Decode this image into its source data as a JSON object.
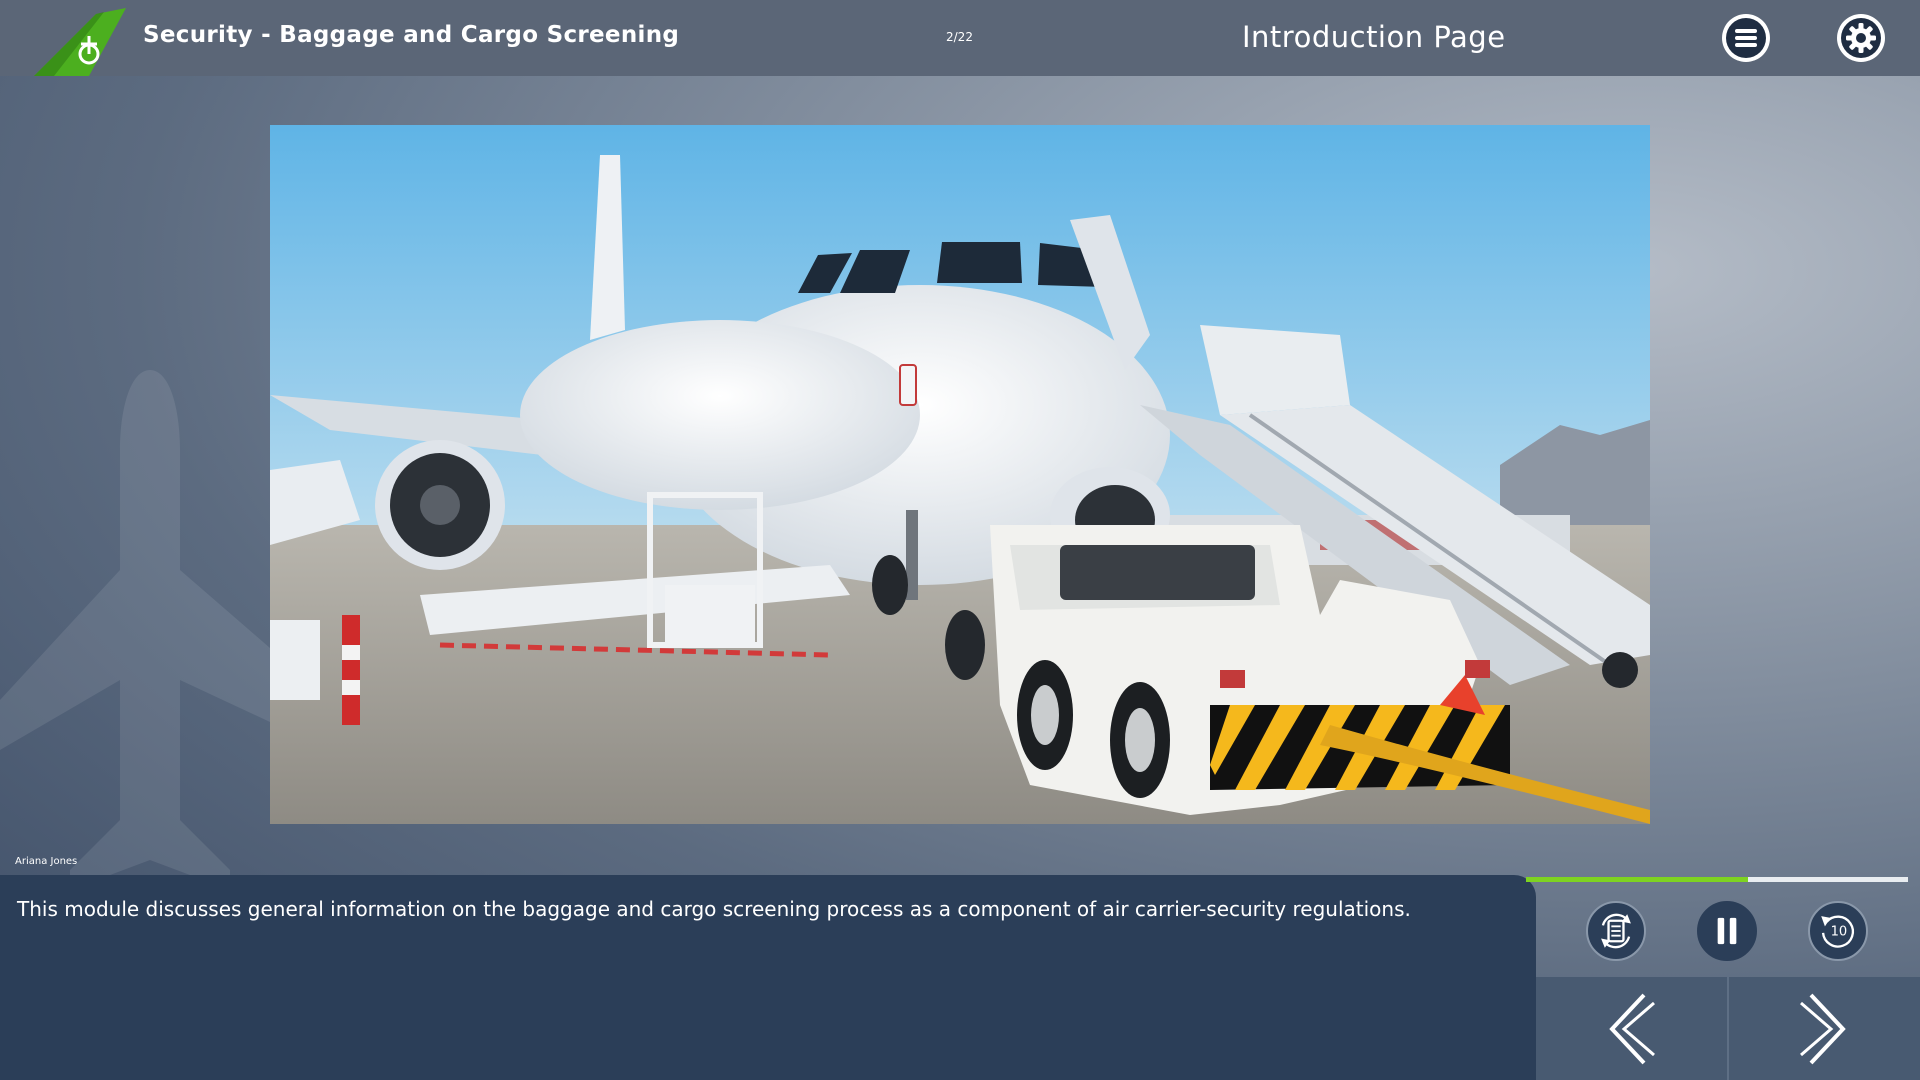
{
  "header": {
    "course_title": "Security - Baggage and Cargo Screening",
    "page_counter": "2/22",
    "page_title": "Introduction Page",
    "menu_icon": "hamburger-menu-icon",
    "settings_icon": "gear-icon"
  },
  "narration": {
    "narrator": "Ariana Jones",
    "transcript": "This module discusses general information on the baggage and cargo screening process as a component of air carrier-security regulations."
  },
  "player": {
    "progress": 0.58,
    "replay_seconds": "10"
  },
  "colors": {
    "accent_green": "#7ed321",
    "logo_green": "#4caf1f",
    "panel_navy": "#2b3e58",
    "topbar": "#5b6677"
  }
}
